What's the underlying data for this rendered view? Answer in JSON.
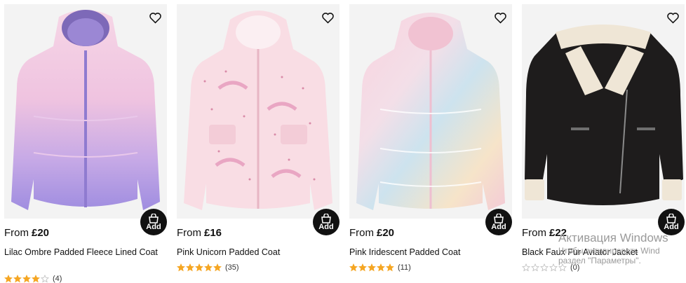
{
  "products": [
    {
      "from_label": "From",
      "price": "£20",
      "name": "Lilac Ombre Padded Fleece Lined Coat",
      "reviews": "(4)",
      "rating": 4,
      "add_label": "Add"
    },
    {
      "from_label": "From",
      "price": "£16",
      "name": "Pink Unicorn Padded Coat",
      "reviews": "(35)",
      "rating": 5,
      "add_label": "Add"
    },
    {
      "from_label": "From",
      "price": "£20",
      "name": "Pink Iridescent Padded Coat",
      "reviews": "(11)",
      "rating": 5,
      "add_label": "Add"
    },
    {
      "from_label": "From",
      "price": "£22",
      "name": "Black Faux Fur Aviator Jacket",
      "reviews": "(0)",
      "rating": 0,
      "add_label": "Add"
    }
  ],
  "icons": {
    "wishlist": "heart-outline-icon",
    "add": "shopping-bag-icon",
    "star": "star-icon"
  },
  "colors": {
    "star_filled": "#f5a623",
    "star_empty": "#bdbdbd",
    "add_button": "#111111"
  },
  "watermark": {
    "line1": "Активация Windows",
    "line2": "Чтобы активировать Wind",
    "line3": "раздел \"Параметры\"."
  }
}
